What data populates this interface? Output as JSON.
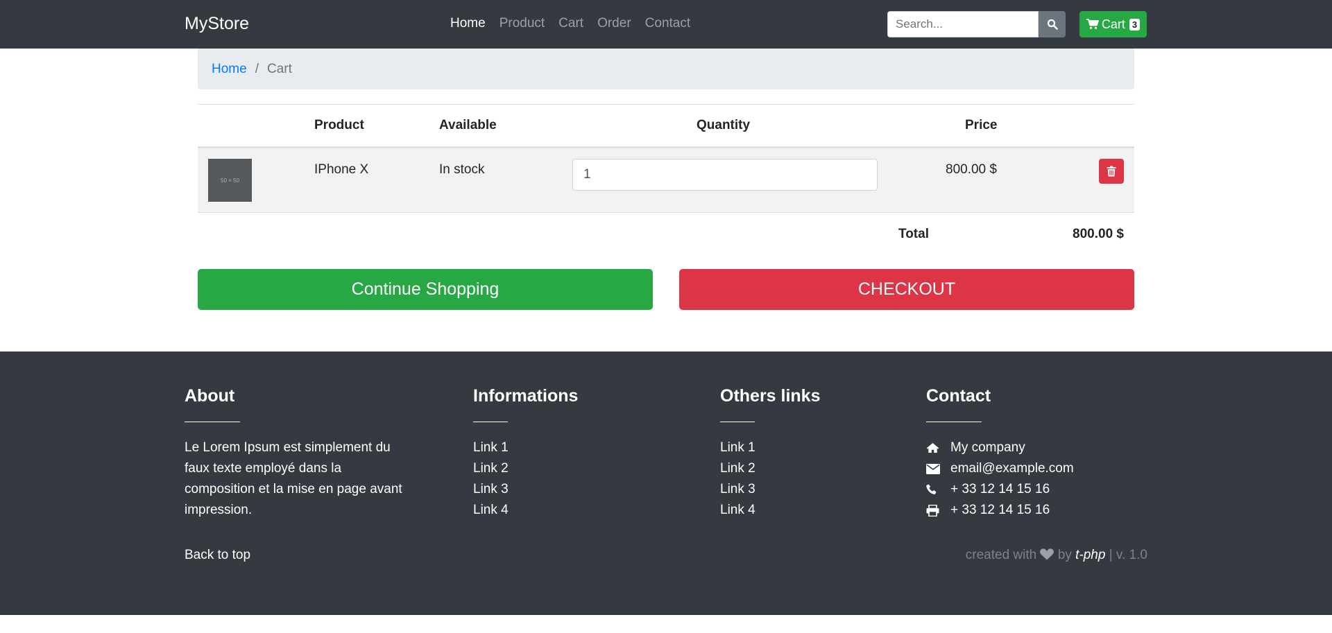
{
  "navbar": {
    "brand": "MyStore",
    "links": [
      "Home",
      "Product",
      "Cart",
      "Order",
      "Contact"
    ],
    "active_index": 0,
    "search": {
      "placeholder": "Search..."
    },
    "cart": {
      "label": "Cart",
      "count": "3"
    }
  },
  "breadcrumb": {
    "home": "Home",
    "separator": "/",
    "current": "Cart"
  },
  "table": {
    "headers": {
      "product": "Product",
      "available": "Available",
      "quantity": "Quantity",
      "price": "Price"
    },
    "rows": [
      {
        "thumb": "50 × 50",
        "product": "IPhone X",
        "available": "In stock",
        "quantity": "1",
        "price": "800.00 $"
      }
    ],
    "total_label": "Total",
    "total_value": "800.00 $"
  },
  "actions": {
    "continue": "Continue Shopping",
    "checkout": "CHECKOUT"
  },
  "footer": {
    "about": {
      "title": "About",
      "text": "Le Lorem Ipsum est simplement du faux texte employé dans la composition et la mise en page avant impression."
    },
    "informations": {
      "title": "Informations",
      "links": [
        "Link 1",
        "Link 2",
        "Link 3",
        "Link 4"
      ]
    },
    "others": {
      "title": "Others links",
      "links": [
        "Link 1",
        "Link 2",
        "Link 3",
        "Link 4"
      ]
    },
    "contact": {
      "title": "Contact",
      "company": "My company",
      "email": "email@example.com",
      "phone": "+ 33 12 14 15 16",
      "fax": "+ 33 12 14 15 16"
    },
    "back_to_top": "Back to top",
    "credits": {
      "prefix": "created with",
      "by": "by",
      "brand": "t-php",
      "version": "| v. 1.0"
    }
  },
  "colors": {
    "navbar": "#343a40",
    "success": "#28a745",
    "danger": "#dc3545",
    "link": "#007bff",
    "breadcrumb_bg": "#e9ecef"
  },
  "icons": [
    "shopping-cart-icon",
    "search-icon",
    "trash-icon",
    "heart-icon",
    "home-icon",
    "envelope-icon",
    "phone-icon",
    "print-icon"
  ]
}
